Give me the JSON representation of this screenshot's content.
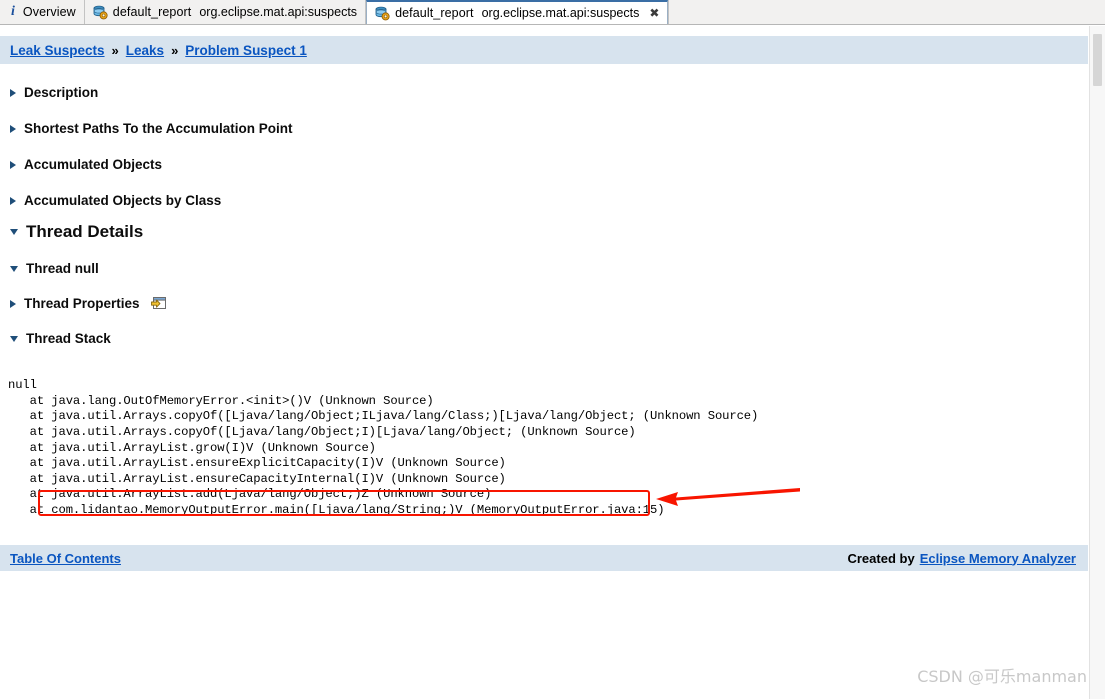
{
  "tabs": [
    {
      "icon": "info-icon",
      "label": "Overview",
      "active": false,
      "closable": false
    },
    {
      "icon": "report-icon",
      "label": "default_report",
      "sublabel": "org.eclipse.mat.api:suspects",
      "active": false,
      "closable": false
    },
    {
      "icon": "report-icon",
      "label": "default_report",
      "sublabel": "org.eclipse.mat.api:suspects",
      "active": true,
      "closable": true,
      "close_glyph": "✖"
    }
  ],
  "breadcrumb": {
    "items": [
      "Leak Suspects",
      "Leaks",
      "Problem Suspect 1"
    ],
    "separator": "»"
  },
  "sections": [
    {
      "label": "Description",
      "expanded": false,
      "big": false,
      "icon": null
    },
    {
      "label": "Shortest Paths To the Accumulation Point",
      "expanded": false,
      "big": false,
      "icon": null
    },
    {
      "label": "Accumulated Objects",
      "expanded": false,
      "big": false,
      "icon": null
    },
    {
      "label": "Accumulated Objects by Class",
      "expanded": false,
      "big": false,
      "icon": null
    },
    {
      "label": "Thread Details",
      "expanded": true,
      "big": true,
      "icon": null
    },
    {
      "label": "Thread null",
      "expanded": true,
      "big": false,
      "icon": null
    },
    {
      "label": "Thread Properties",
      "expanded": false,
      "big": false,
      "icon": "open-window-icon"
    },
    {
      "label": "Thread Stack",
      "expanded": true,
      "big": false,
      "icon": null
    }
  ],
  "stack_trace": {
    "text": "null\n   at java.lang.OutOfMemoryError.<init>()V (Unknown Source)\n   at java.util.Arrays.copyOf([Ljava/lang/Object;ILjava/lang/Class;)[Ljava/lang/Object; (Unknown Source)\n   at java.util.Arrays.copyOf([Ljava/lang/Object;I)[Ljava/lang/Object; (Unknown Source)\n   at java.util.ArrayList.grow(I)V (Unknown Source)\n   at java.util.ArrayList.ensureExplicitCapacity(I)V (Unknown Source)\n   at java.util.ArrayList.ensureCapacityInternal(I)V (Unknown Source)\n   at java.util.ArrayList.add(Ljava/lang/Object;)Z (Unknown Source)\n   at com.lidantao.MemoryOutputError.main([Ljava/lang/String;)V (MemoryOutputError.java:15)"
  },
  "annotation": {
    "highlight_color": "#f81500",
    "target_line": "com.lidantao.MemoryOutputError.main([Ljava/lang/String;)V (MemoryOutputError.java:15)"
  },
  "footer": {
    "toc_label": "Table Of Contents",
    "created_by_label": "Created by",
    "creator_link": "Eclipse Memory Analyzer"
  },
  "watermark": {
    "text": "CSDN @可乐manman"
  },
  "colors": {
    "breadcrumb_bg": "#d7e3ee",
    "link_blue": "#0a55c0",
    "triangle_blue": "#1f4e79",
    "annotation_red": "#f81500"
  }
}
